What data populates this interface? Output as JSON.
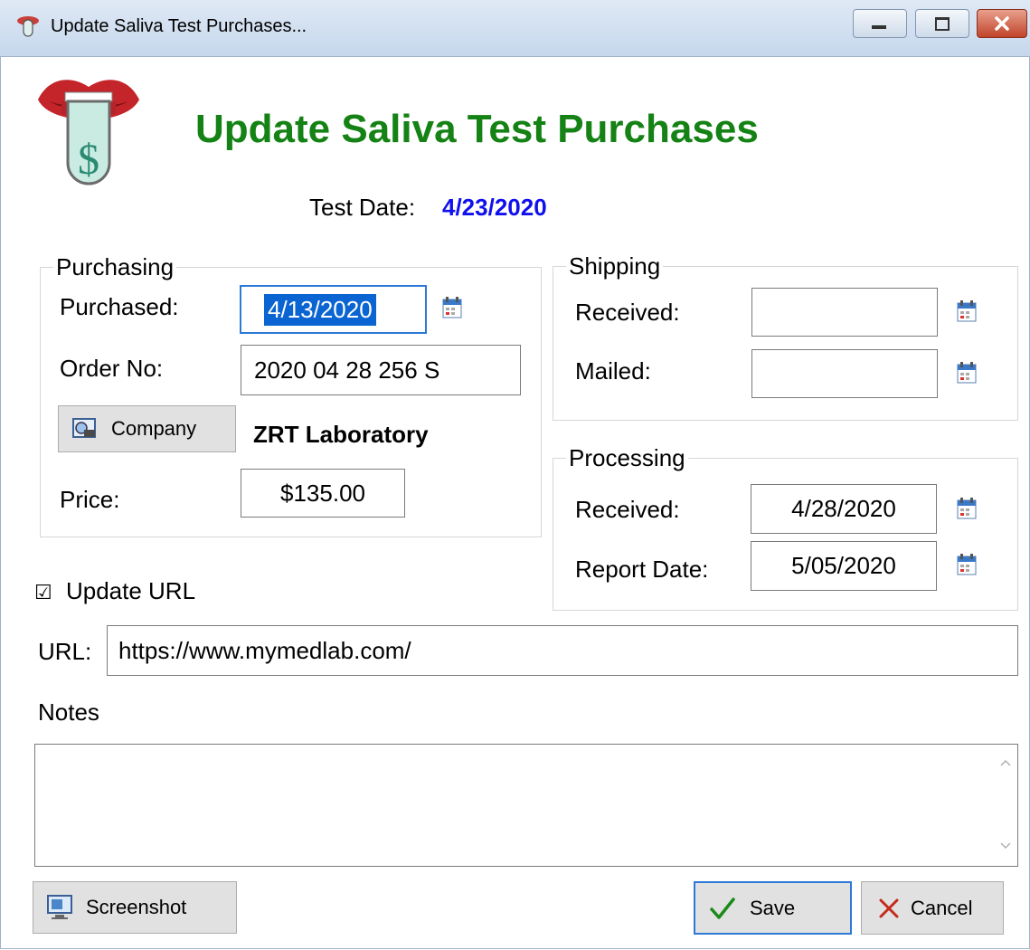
{
  "window": {
    "title": "Update Saliva Test Purchases..."
  },
  "header": {
    "title": "Update Saliva Test Purchases",
    "test_date_label": "Test Date:",
    "test_date_value": "4/23/2020"
  },
  "purchasing": {
    "legend": "Purchasing",
    "purchased_label": "Purchased:",
    "purchased_value": "4/13/2020",
    "order_label": "Order No:",
    "order_value": "2020 04 28 256 S",
    "company_button": "Company",
    "company_name": "ZRT Laboratory",
    "price_label": "Price:",
    "price_value": "$135.00"
  },
  "shipping": {
    "legend": "Shipping",
    "received_label": "Received:",
    "received_value": "",
    "mailed_label": "Mailed:",
    "mailed_value": ""
  },
  "processing": {
    "legend": "Processing",
    "received_label": "Received:",
    "received_value": "4/28/2020",
    "report_label": "Report Date:",
    "report_value": "5/05/2020"
  },
  "update_url": {
    "label": "Update URL",
    "checked": true,
    "check_glyph": "☑"
  },
  "url": {
    "label": "URL:",
    "value": "https://www.mymedlab.com/"
  },
  "notes": {
    "label": "Notes",
    "value": ""
  },
  "buttons": {
    "screenshot": "Screenshot",
    "save": "Save",
    "cancel": "Cancel"
  },
  "colors": {
    "heading": "#148214",
    "test_date": "#1010ee",
    "focus": "#2d7ad6",
    "selection": "#0a64d2"
  }
}
